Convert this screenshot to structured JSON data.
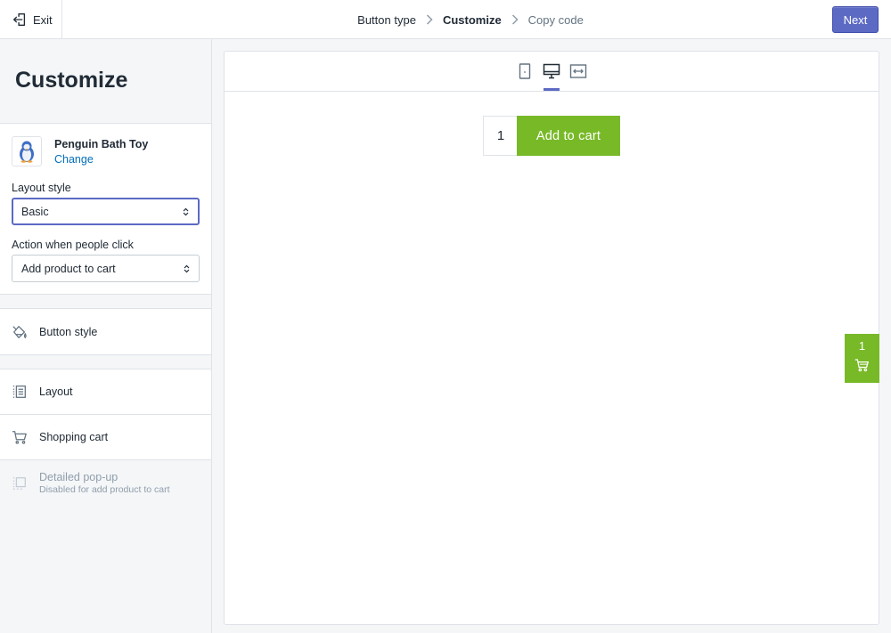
{
  "topbar": {
    "exit_label": "Exit",
    "steps": [
      {
        "label": "Button type",
        "state": "done"
      },
      {
        "label": "Customize",
        "state": "active"
      },
      {
        "label": "Copy code",
        "state": "upcoming"
      }
    ],
    "next_label": "Next",
    "accent_color": "#5c6ac4"
  },
  "sidebar": {
    "title": "Customize",
    "product": {
      "name": "Penguin Bath Toy",
      "change_label": "Change",
      "thumb_icon": "penguin-toy-image"
    },
    "layout_style": {
      "label": "Layout style",
      "value": "Basic"
    },
    "click_action": {
      "label": "Action when people click",
      "value": "Add product to cart"
    },
    "items": [
      {
        "label": "Button style",
        "icon": "paint-bucket-icon"
      },
      {
        "label": "Layout",
        "icon": "layout-icon"
      },
      {
        "label": "Shopping cart",
        "icon": "cart-icon"
      },
      {
        "label": "Detailed pop-up",
        "sublabel": "Disabled for add product to cart",
        "icon": "popup-icon",
        "disabled": true
      }
    ]
  },
  "preview": {
    "devices": [
      {
        "name": "mobile",
        "icon": "mobile-icon"
      },
      {
        "name": "desktop",
        "icon": "desktop-icon",
        "selected": true
      },
      {
        "name": "full-width",
        "icon": "full-width-icon"
      }
    ],
    "quantity": "1",
    "add_to_cart_label": "Add to cart",
    "button_color": "#78b928",
    "cart_tab_count": "1"
  }
}
